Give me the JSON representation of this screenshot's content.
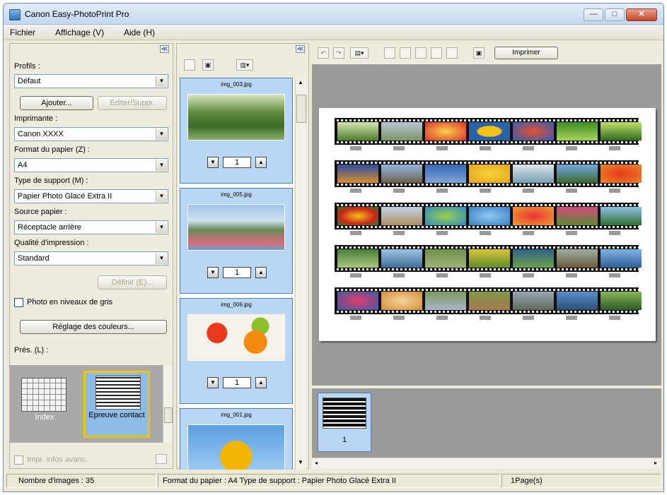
{
  "window": {
    "title": "Canon Easy-PhotoPrint Pro",
    "minimize": "—",
    "maximize": "□",
    "close": "✕"
  },
  "menu": [
    "Fichier",
    "Affichage (V)",
    "Aide (H)"
  ],
  "left": {
    "collapse": "≪",
    "profile_label": "Profils :",
    "profile_value": "Défaut",
    "add_button": "Ajouter...",
    "edit_button": "Editer/Suppr.",
    "printer_label": "Imprimante :",
    "printer_value": "Canon XXXX",
    "paper_size_label": "Format du papier (Z) :",
    "paper_size_value": "A4",
    "media_label": "Type de support (M) :",
    "media_value": "Papier Photo Glacé Extra II",
    "source_label": "Source papier :",
    "source_value": "Réceptacle arrière",
    "quality_label": "Qualité d'impression :",
    "quality_value": "Standard",
    "define_button": "Définir (E)...",
    "grayscale_label": "Photo en niveaux de gris",
    "grayscale_checked": false,
    "color_button": "Réglage des couleurs...",
    "layout_label": "Prés. (L) :",
    "layouts": [
      {
        "label": "Index",
        "selected": false
      },
      {
        "label": "Epreuve contact",
        "selected": true
      }
    ],
    "adv_label": "Impr. infos avanc.",
    "adv_checked": false
  },
  "mid": {
    "collapse": "≪",
    "thumbnails": [
      {
        "name": "img_003.jpg",
        "count": "1",
        "selected": true
      },
      {
        "name": "img_005.jpg",
        "count": "1",
        "selected": false
      },
      {
        "name": "img_006.jpg",
        "count": "1",
        "selected": true
      },
      {
        "name": "img_001.jpg",
        "count": "",
        "selected": true
      }
    ]
  },
  "right": {
    "print_button": "Imprimer",
    "page_number": "1"
  },
  "status": {
    "images": "Nombre d'images : 35",
    "format": "Format du papier : A4  Type de support : Papier Photo Glacé Extra II",
    "pages": "1Page(s)"
  }
}
